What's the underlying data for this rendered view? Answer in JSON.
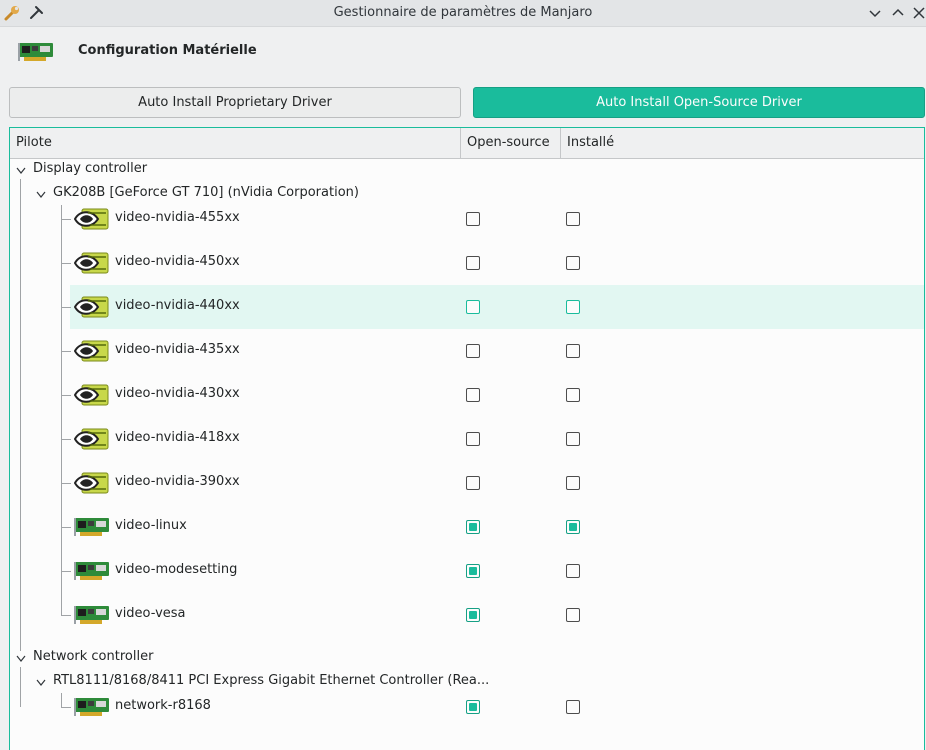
{
  "window": {
    "title": "Gestionnaire de paramètres de Manjaro",
    "left_icons": [
      "wrench-icon",
      "pin-icon"
    ],
    "controls": [
      "minimize-icon",
      "maximize-icon",
      "close-icon"
    ]
  },
  "header": {
    "title": "Configuration Matérielle",
    "icon": "network-card-icon"
  },
  "buttons": {
    "proprietary": "Auto Install Proprietary Driver",
    "open_source": "Auto Install Open-Source Driver"
  },
  "columns": [
    "Pilote",
    "Open-source",
    "Installé"
  ],
  "groups": [
    {
      "label": "Display controller",
      "device": "GK208B [GeForce GT 710] (nVidia Corporation)",
      "drivers": [
        {
          "name": "video-nvidia-455xx",
          "icon": "nvidia-icon",
          "open_source": false,
          "installed": false
        },
        {
          "name": "video-nvidia-450xx",
          "icon": "nvidia-icon",
          "open_source": false,
          "installed": false
        },
        {
          "name": "video-nvidia-440xx",
          "icon": "nvidia-icon",
          "open_source": false,
          "installed": false
        },
        {
          "name": "video-nvidia-435xx",
          "icon": "nvidia-icon",
          "open_source": false,
          "installed": false
        },
        {
          "name": "video-nvidia-430xx",
          "icon": "nvidia-icon",
          "open_source": false,
          "installed": false
        },
        {
          "name": "video-nvidia-418xx",
          "icon": "nvidia-icon",
          "open_source": false,
          "installed": false
        },
        {
          "name": "video-nvidia-390xx",
          "icon": "nvidia-icon",
          "open_source": false,
          "installed": false
        },
        {
          "name": "video-linux",
          "icon": "hardware-card-icon",
          "open_source": true,
          "installed": true
        },
        {
          "name": "video-modesetting",
          "icon": "hardware-card-icon",
          "open_source": true,
          "installed": false
        },
        {
          "name": "video-vesa",
          "icon": "hardware-card-icon",
          "open_source": true,
          "installed": false
        }
      ]
    },
    {
      "label": "Network controller",
      "device": "RTL8111/8168/8411 PCI Express Gigabit Ethernet Controller (Rea...",
      "drivers": [
        {
          "name": "network-r8168",
          "icon": "hardware-card-icon",
          "open_source": true,
          "installed": false
        }
      ]
    }
  ],
  "highlighted_driver": "video-nvidia-440xx",
  "colors": {
    "accent": "#1abc9c",
    "highlight": "#e2f7f2"
  }
}
